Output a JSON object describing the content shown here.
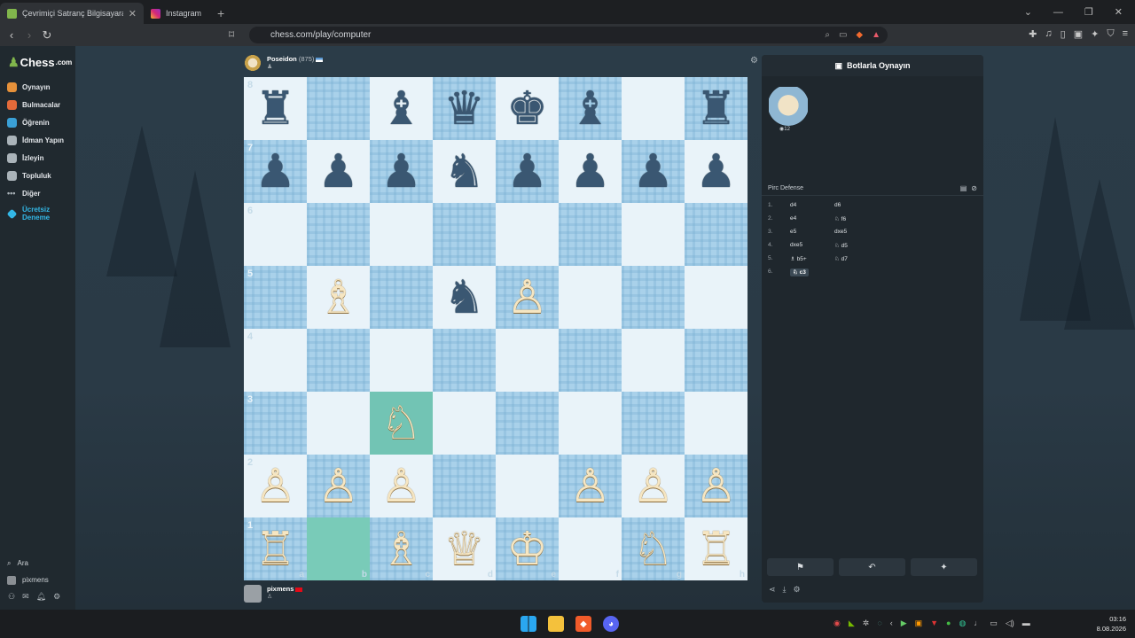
{
  "browser": {
    "tabs": [
      {
        "title": "Çevrimiçi Satranç Bilgisayara...",
        "active": true
      },
      {
        "title": "Instagram",
        "active": false
      }
    ],
    "url": "chess.com/play/computer"
  },
  "sidebar": {
    "logo": "Chess",
    "logo_suffix": ".com",
    "items": [
      {
        "label": "Oynayın",
        "icon": "play-icon",
        "color": "#e6913a"
      },
      {
        "label": "Bulmacalar",
        "icon": "puzzle-icon",
        "color": "#e46a3a"
      },
      {
        "label": "Öğrenin",
        "icon": "learn-icon",
        "color": "#3aa0d6"
      },
      {
        "label": "İdman Yapın",
        "icon": "train-icon",
        "color": "#aab3b9"
      },
      {
        "label": "İzleyin",
        "icon": "watch-icon",
        "color": "#aab3b9"
      },
      {
        "label": "Topluluk",
        "icon": "community-icon",
        "color": "#aab3b9"
      },
      {
        "label": "Diğer",
        "icon": "more-icon",
        "color": "#aab3b9"
      },
      {
        "label": "Ücretsiz Deneme",
        "icon": "diamond-icon",
        "color": "#33b7e6"
      }
    ],
    "search_label": "Ara",
    "user_label": "pixmens"
  },
  "top_player": {
    "name": "Poseidon",
    "rating": "(875)"
  },
  "bottom_player": {
    "name": "pixmens"
  },
  "board": {
    "ranks": [
      "8",
      "7",
      "6",
      "5",
      "4",
      "3",
      "2",
      "1"
    ],
    "files": [
      "a",
      "b",
      "c",
      "d",
      "e",
      "f",
      "g",
      "h"
    ],
    "rows": [
      [
        "♜",
        "",
        "♝",
        "♛",
        "♚",
        "♝",
        "",
        "♜"
      ],
      [
        "♟",
        "♟",
        "♟",
        "♞",
        "♟",
        "♟",
        "♟",
        "♟"
      ],
      [
        "",
        "",
        "",
        "",
        "",
        "",
        "",
        ""
      ],
      [
        "",
        "♗",
        "",
        "♞",
        "♙",
        "",
        "",
        ""
      ],
      [
        "",
        "",
        "",
        "",
        "",
        "",
        "",
        ""
      ],
      [
        "",
        "",
        "♘",
        "",
        "",
        "",
        "",
        ""
      ],
      [
        "♙",
        "♙",
        "♙",
        "",
        "",
        "♙",
        "♙",
        "♙"
      ],
      [
        "♖",
        "",
        "♗",
        "♕",
        "♔",
        "",
        "♘",
        "♖"
      ]
    ],
    "colors": [
      [
        "b",
        "",
        "b",
        "b",
        "b",
        "b",
        "",
        "b"
      ],
      [
        "b",
        "b",
        "b",
        "b",
        "b",
        "b",
        "b",
        "b"
      ],
      [
        "",
        "",
        "",
        "",
        "",
        "",
        "",
        ""
      ],
      [
        "",
        "w",
        "",
        "b",
        "w",
        "",
        "",
        ""
      ],
      [
        "",
        "",
        "",
        "",
        "",
        "",
        "",
        ""
      ],
      [
        "",
        "",
        "w",
        "",
        "",
        "",
        "",
        ""
      ],
      [
        "w",
        "w",
        "w",
        "",
        "",
        "w",
        "w",
        "w"
      ],
      [
        "w",
        "",
        "w",
        "w",
        "w",
        "",
        "w",
        "w"
      ]
    ]
  },
  "panel": {
    "title": "Botlarla Oynayın",
    "bot_level": "12",
    "opening": "Pirc Defense",
    "moves": [
      {
        "n": "1.",
        "w": "d4",
        "b": "d6"
      },
      {
        "n": "2.",
        "w": "e4",
        "b": "♘ f6"
      },
      {
        "n": "3.",
        "w": "e5",
        "b": "dxe5"
      },
      {
        "n": "4.",
        "w": "dxe5",
        "b": "♘ d5"
      },
      {
        "n": "5.",
        "w": "♗ b5+",
        "b": "♘ d7"
      },
      {
        "n": "6.",
        "w": "♘ c3",
        "b": ""
      }
    ]
  },
  "taskbar": {
    "time": "03:16",
    "date": "8.08.2026"
  }
}
